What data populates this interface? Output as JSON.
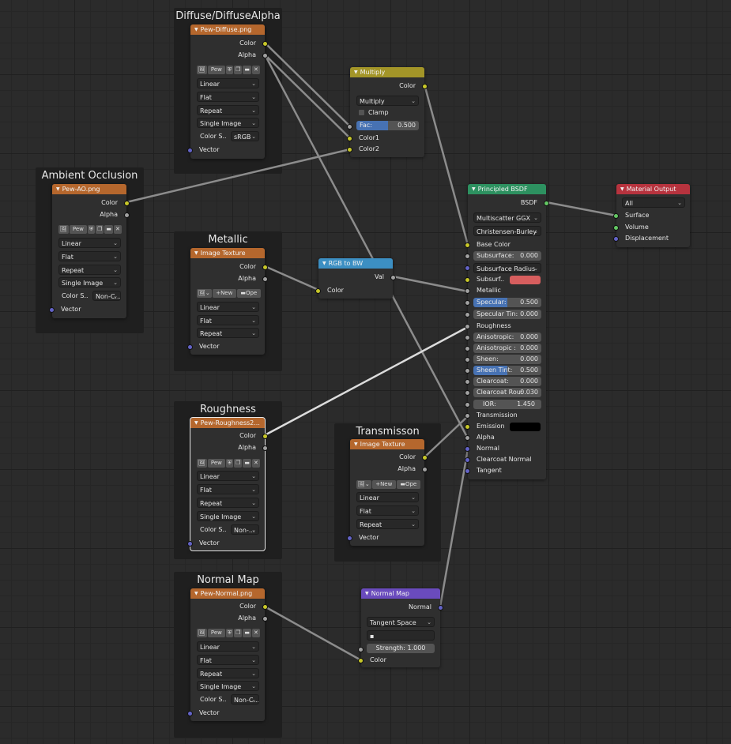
{
  "frames": {
    "diffuse": "Diffuse/DiffuseAlpha",
    "ambient": "Ambient Occlusion",
    "metallic": "Metallic",
    "roughness": "Roughness",
    "transmission": "Transmisson",
    "normal": "Normal Map"
  },
  "tex_diffuse": {
    "title": "Pew-Diffuse.png",
    "out_color": "Color",
    "out_alpha": "Alpha",
    "img_name": "Pew",
    "interp": "Linear",
    "proj": "Flat",
    "ext": "Repeat",
    "source": "Single Image",
    "cs_label": "Color S..",
    "cs_value": "sRGB",
    "in_vector": "Vector"
  },
  "tex_ao": {
    "title": "Pew-AO.png",
    "out_color": "Color",
    "out_alpha": "Alpha",
    "img_name": "Pew",
    "interp": "Linear",
    "proj": "Flat",
    "ext": "Repeat",
    "source": "Single Image",
    "cs_label": "Color S..",
    "cs_value": "Non-C...",
    "in_vector": "Vector"
  },
  "tex_metallic": {
    "title": "Image Texture",
    "out_color": "Color",
    "out_alpha": "Alpha",
    "new_label": "New",
    "open_label": "Ope",
    "interp": "Linear",
    "proj": "Flat",
    "ext": "Repeat",
    "in_vector": "Vector"
  },
  "tex_roughness": {
    "title": "Pew-Roughness2...",
    "out_color": "Color",
    "out_alpha": "Alpha",
    "img_name": "Pew",
    "interp": "Linear",
    "proj": "Flat",
    "ext": "Repeat",
    "source": "Single Image",
    "cs_label": "Color S..",
    "cs_value": "Non-...",
    "in_vector": "Vector"
  },
  "tex_transmission": {
    "title": "Image Texture",
    "out_color": "Color",
    "out_alpha": "Alpha",
    "new_label": "New",
    "open_label": "Ope",
    "interp": "Linear",
    "proj": "Flat",
    "ext": "Repeat",
    "in_vector": "Vector"
  },
  "tex_normal": {
    "title": "Pew-Normal.png",
    "out_color": "Color",
    "out_alpha": "Alpha",
    "img_name": "Pew",
    "interp": "Linear",
    "proj": "Flat",
    "ext": "Repeat",
    "source": "Single Image",
    "cs_label": "Color S..",
    "cs_value": "Non-C...",
    "in_vector": "Vector"
  },
  "multiply": {
    "title": "Multiply",
    "out_color": "Color",
    "blend_mode": "Multiply",
    "clamp_label": "Clamp",
    "fac_label": "Fac:",
    "fac_value": "0.500",
    "fac_fraction": 0.5,
    "in_color1": "Color1",
    "in_color2": "Color2"
  },
  "rgb_to_bw": {
    "title": "RGB to BW",
    "out_val": "Val",
    "in_color": "Color"
  },
  "normal_map": {
    "title": "Normal Map",
    "out_normal": "Normal",
    "space": "Tangent Space",
    "uv_value": "",
    "strength_label": "Strength:",
    "strength_value": "1.000",
    "in_color": "Color"
  },
  "bsdf": {
    "title": "Principled BSDF",
    "out_bsdf": "BSDF",
    "distribution": "Multiscatter GGX",
    "subsurface_method": "Christensen-Burley",
    "base_color": "Base Color",
    "subsurface": {
      "label": "Subsurface:",
      "value": "0.000"
    },
    "subsurface_radius": "Subsurface Radius",
    "subsurface_color": {
      "label": "Subsurf..",
      "swatch": "#d75e5e"
    },
    "metallic": "Metallic",
    "specular": {
      "label": "Specular:",
      "value": "0.500",
      "fraction": 0.5
    },
    "specular_tint": {
      "label": "Specular Tin:",
      "value": "0.000"
    },
    "roughness": "Roughness",
    "anisotropic": {
      "label": "Anisotropic:",
      "value": "0.000"
    },
    "anisotropic_rot": {
      "label": "Anisotropic :",
      "value": "0.000"
    },
    "sheen": {
      "label": "Sheen:",
      "value": "0.000"
    },
    "sheen_tint": {
      "label": "Sheen Tint:",
      "value": "0.500",
      "fraction": 0.5
    },
    "clearcoat": {
      "label": "Clearcoat:",
      "value": "0.000"
    },
    "clearcoat_rough": {
      "label": "Clearcoat Rou:",
      "value": "0.030"
    },
    "ior": {
      "label": "IOR:",
      "value": "1.450"
    },
    "transmission": "Transmission",
    "emission": {
      "label": "Emission",
      "swatch": "#000000"
    },
    "alpha": "Alpha",
    "normal": "Normal",
    "clearcoat_normal": "Clearcoat Normal",
    "tangent": "Tangent"
  },
  "material_output": {
    "title": "Material Output",
    "target": "All",
    "in_surface": "Surface",
    "in_volume": "Volume",
    "in_displacement": "Displacement"
  },
  "colors": {
    "texture_header": "#b5672d",
    "color_header": "#a39528",
    "converter_header": "#3c8fc3",
    "shader_header": "#2d9160",
    "output_header": "#b7333e",
    "vector_header": "#6a4bbd",
    "socket_color": "#c7c729",
    "socket_float": "#a1a1a1",
    "socket_vector": "#6363c7",
    "socket_shader": "#63c763",
    "slider_fill": "#4772b3"
  }
}
